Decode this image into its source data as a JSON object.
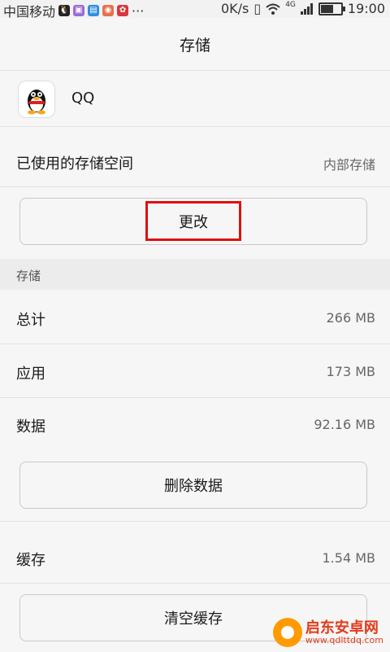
{
  "status_bar": {
    "carrier": "中国移动",
    "more": "···",
    "speed": "0K/s",
    "network": "4G",
    "time": "19:00",
    "battery_level": 0.7
  },
  "header": {
    "title": "存储"
  },
  "app": {
    "name": "QQ",
    "icon": "qq-penguin-icon"
  },
  "storage_used": {
    "label": "已使用的存储空间",
    "value": "内部存储"
  },
  "change_button": {
    "label": "更改"
  },
  "section": {
    "header": "存储"
  },
  "stats": [
    {
      "label": "总计",
      "value": "266 MB"
    },
    {
      "label": "应用",
      "value": "173 MB"
    },
    {
      "label": "数据",
      "value": "92.16 MB"
    }
  ],
  "clear_data_button": {
    "label": "删除数据"
  },
  "cache": {
    "label": "缓存",
    "value": "1.54 MB"
  },
  "clear_cache_button": {
    "label": "清空缓存"
  },
  "watermark": {
    "line1": "启东安卓网",
    "line2": "www.qdlttdq.com"
  },
  "colors": {
    "highlight": "#e01010",
    "watermark": "#ff9a00"
  }
}
